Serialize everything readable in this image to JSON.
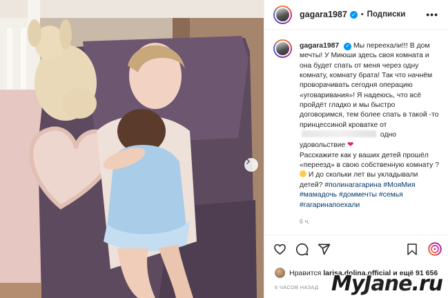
{
  "post": {
    "username": "gagara1987",
    "follow_label": "Подписки",
    "separator": "•",
    "more_label": "•••",
    "caption_username": "gagara1987",
    "caption_part1": "Мы переехали!!! В дом мечты! У Миюши здесь своя комната и она будет спать от меня через одну комнату, комнату брата! Так что начнём проворачивать сегодня операцию «уговаривания»! Я надеюсь, что всё пройдёт гладко и мы быстро договоримся, тем более спать в такой -то принцессиной кроватке от",
    "caption_part2": "одно удовольствие",
    "caption_part3": "Расскажите как у ваших детей прошёл «переезд» в свою собственную комнату ?",
    "caption_part4": "И до скольки лет вы укладывали детей?",
    "hashtags": [
      "#полинагагарина",
      "#МояМия",
      "#мамадочь",
      "#доммечты",
      "#семья",
      "#гагаринапоехали"
    ],
    "time_short": "6 ч.",
    "likes_prefix": "Нравится",
    "likes_user": "larisa.dolina.official",
    "likes_suffix": "и ещё 91 656",
    "posted_ago": "6 ЧАСОВ НАЗАД"
  },
  "icons": {
    "verified": "verified-badge-icon",
    "heart": "heart-icon",
    "comment": "comment-icon",
    "share": "share-icon",
    "save": "bookmark-icon",
    "next": "chevron-right-icon"
  },
  "watermark": {
    "part1": "My",
    "part2": "Jane",
    "part3": ".ru"
  },
  "colors": {
    "link": "#00376b",
    "verified": "#0095f6",
    "muted": "#8e8e8e"
  }
}
